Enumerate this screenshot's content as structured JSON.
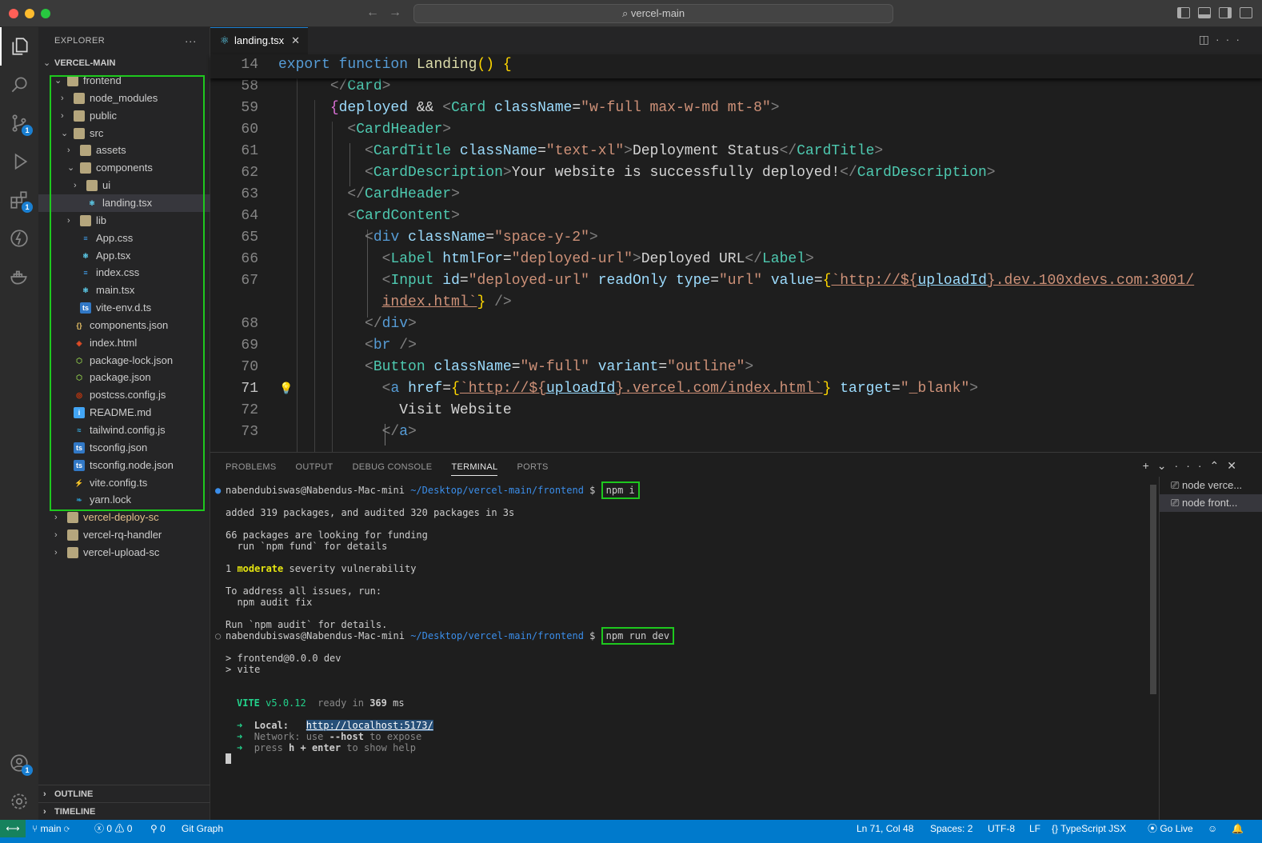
{
  "window": {
    "title": "vercel-main"
  },
  "explorer": {
    "header": "EXPLORER",
    "root": "VERCEL-MAIN",
    "items": [
      {
        "label": "frontend",
        "depth": 1,
        "chev": "⌄",
        "icon": "folder-icon"
      },
      {
        "label": "node_modules",
        "depth": 2,
        "chev": "›",
        "icon": "folder-icon"
      },
      {
        "label": "public",
        "depth": 2,
        "chev": "›",
        "icon": "folder-icon"
      },
      {
        "label": "src",
        "depth": 2,
        "chev": "⌄",
        "icon": "folder-icon"
      },
      {
        "label": "assets",
        "depth": 3,
        "chev": "›",
        "icon": "folder-icon"
      },
      {
        "label": "components",
        "depth": 3,
        "chev": "⌄",
        "icon": "folder-icon"
      },
      {
        "label": "ui",
        "depth": 4,
        "chev": "›",
        "icon": "folder-icon"
      },
      {
        "label": "landing.tsx",
        "depth": 4,
        "chev": "",
        "icon": "react-icon"
      },
      {
        "label": "lib",
        "depth": 3,
        "chev": "›",
        "icon": "folder-icon"
      },
      {
        "label": "App.css",
        "depth": 3,
        "chev": "",
        "icon": "css-icon"
      },
      {
        "label": "App.tsx",
        "depth": 3,
        "chev": "",
        "icon": "react-icon"
      },
      {
        "label": "index.css",
        "depth": 3,
        "chev": "",
        "icon": "css-icon"
      },
      {
        "label": "main.tsx",
        "depth": 3,
        "chev": "",
        "icon": "react-icon"
      },
      {
        "label": "vite-env.d.ts",
        "depth": 3,
        "chev": "",
        "icon": "ts-icon"
      },
      {
        "label": "components.json",
        "depth": 2,
        "chev": "",
        "icon": "json-icon"
      },
      {
        "label": "index.html",
        "depth": 2,
        "chev": "",
        "icon": "html-icon"
      },
      {
        "label": "package-lock.json",
        "depth": 2,
        "chev": "",
        "icon": "npm-icon"
      },
      {
        "label": "package.json",
        "depth": 2,
        "chev": "",
        "icon": "npm-icon"
      },
      {
        "label": "postcss.config.js",
        "depth": 2,
        "chev": "",
        "icon": "postcss-icon"
      },
      {
        "label": "README.md",
        "depth": 2,
        "chev": "",
        "icon": "info-icon"
      },
      {
        "label": "tailwind.config.js",
        "depth": 2,
        "chev": "",
        "icon": "tailwind-icon"
      },
      {
        "label": "tsconfig.json",
        "depth": 2,
        "chev": "",
        "icon": "tsconfig-icon"
      },
      {
        "label": "tsconfig.node.json",
        "depth": 2,
        "chev": "",
        "icon": "tsconfig-icon"
      },
      {
        "label": "vite.config.ts",
        "depth": 2,
        "chev": "",
        "icon": "vite-icon"
      },
      {
        "label": "yarn.lock",
        "depth": 2,
        "chev": "",
        "icon": "yarn-icon"
      },
      {
        "label": "vercel-deploy-sc",
        "depth": 1,
        "chev": "›",
        "icon": "folder-icon"
      },
      {
        "label": "vercel-rq-handler",
        "depth": 1,
        "chev": "›",
        "icon": "folder-icon"
      },
      {
        "label": "vercel-upload-sc",
        "depth": 1,
        "chev": "›",
        "icon": "folder-icon"
      }
    ],
    "outline": "OUTLINE",
    "timeline": "TIMELINE"
  },
  "editor": {
    "tab": "landing.tsx",
    "sticky": {
      "line": "14"
    },
    "lines": [
      "58",
      "59",
      "60",
      "61",
      "62",
      "63",
      "64",
      "65",
      "66",
      "67",
      "",
      "68",
      "69",
      "70",
      "71",
      "72",
      "73"
    ]
  },
  "panel": {
    "tabs": [
      "PROBLEMS",
      "OUTPUT",
      "DEBUG CONSOLE",
      "TERMINAL",
      "PORTS"
    ],
    "prompt_user": "nabendubiswas@Nabendus-Mac-mini",
    "prompt_path": "~/Desktop/vercel-main/frontend",
    "cmd1": "npm i",
    "cmd2": "npm run dev",
    "out": [
      "added 319 packages, and audited 320 packages in 3s",
      "66 packages are looking for funding",
      "  run `npm fund` for details",
      "1 ",
      "moderate",
      " severity vulnerability",
      "To address all issues, run:",
      "  npm audit fix",
      "Run `npm audit` for details.",
      "> frontend@0.0.0 dev",
      "> vite"
    ],
    "vite": {
      "name": "VITE",
      "version": "v5.0.12",
      "ready": "ready in",
      "ms": "369",
      "unit": "ms"
    },
    "local_label": "Local:",
    "local_url": "http://localhost:5173/",
    "network": "Network: use ",
    "network_flag": "--host",
    "network_tail": " to expose",
    "help": "press ",
    "help_key": "h + enter",
    "help_tail": " to show help",
    "terminals": [
      "node  verce...",
      "node  front..."
    ]
  },
  "status": {
    "branch": "main",
    "errors": "0",
    "warnings": "0",
    "ports": "0",
    "git_graph": "Git Graph",
    "position": "Ln 71, Col 48",
    "spaces": "Spaces: 2",
    "encoding": "UTF-8",
    "eol": "LF",
    "language": "TypeScript JSX",
    "golive": "Go Live"
  },
  "colors": {
    "accent": "#007acc",
    "highlight": "#1ec81e"
  }
}
